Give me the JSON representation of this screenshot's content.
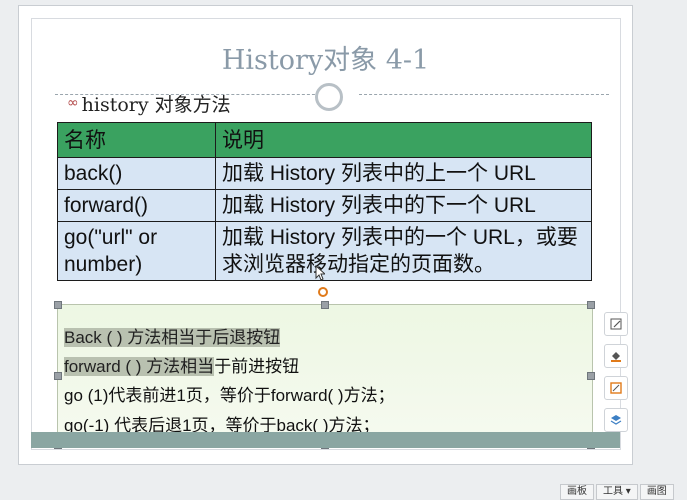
{
  "slide": {
    "title": "History对象 4-1",
    "bullet_icon": "∞",
    "bullet_text": "history 对象方法"
  },
  "table": {
    "headers": [
      "名称",
      "说明"
    ],
    "rows": [
      [
        "back()",
        "加载 History 列表中的上一个 URL"
      ],
      [
        "forward()",
        "加载 History 列表中的下一个 URL"
      ],
      [
        "go(\"url\" or number)",
        "加载 History 列表中的一个 URL，或要求浏览器移动指定的页面数。"
      ]
    ]
  },
  "notes": {
    "lines": [
      "Back ( ) 方法相当于后退按钮",
      "forward ( ) 方法相当于前进按钮",
      "go (1)代表前进1页，等价于forward( )方法；",
      "go(-1) 代表后退1页，等价于back( )方法；"
    ],
    "line1_part1": "Back ( ) 方法相当于后退按钮",
    "line2_part1": "forward ( ) 方法相当",
    "line2_part2": "于前进按钮"
  },
  "side_tools": [
    {
      "icon": "edit-icon"
    },
    {
      "icon": "fill-icon"
    },
    {
      "icon": "outline-icon"
    },
    {
      "icon": "layers-icon"
    }
  ],
  "statusbar": {
    "items": [
      "画板",
      "工具 ▾",
      "画图"
    ]
  },
  "colors": {
    "header_green": "#3aa260",
    "cell_blue": "#d7e5f4",
    "title_gray": "#8a9aa8",
    "notes_green": "#edf7e3"
  }
}
